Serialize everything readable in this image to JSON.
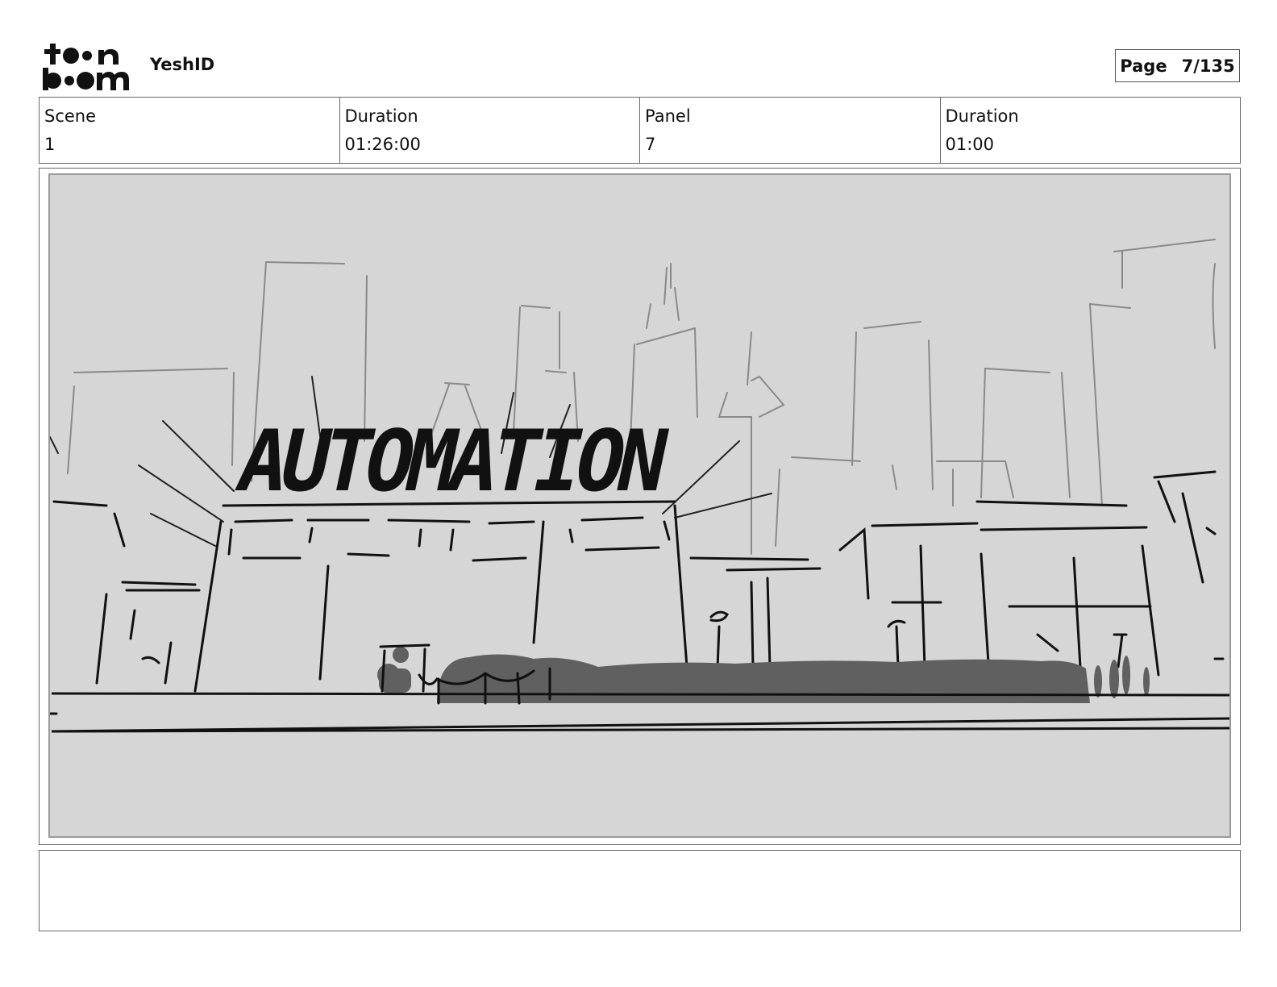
{
  "header": {
    "logo_text_top": "toon",
    "logo_text_bottom": "boom",
    "project_title": "YeshID",
    "page_label": "Page",
    "page_value": "7/135"
  },
  "info": {
    "scene_label": "Scene",
    "scene_value": "1",
    "duration_label": "Duration",
    "duration_value": "01:26:00",
    "panel_label": "Panel",
    "panel_value": "7",
    "panel_duration_label": "Duration",
    "panel_duration_value": "01:00"
  },
  "panel": {
    "sign_text": "AUTOMATION",
    "background_color": "#d6d6d6"
  },
  "notes": {
    "text": ""
  }
}
